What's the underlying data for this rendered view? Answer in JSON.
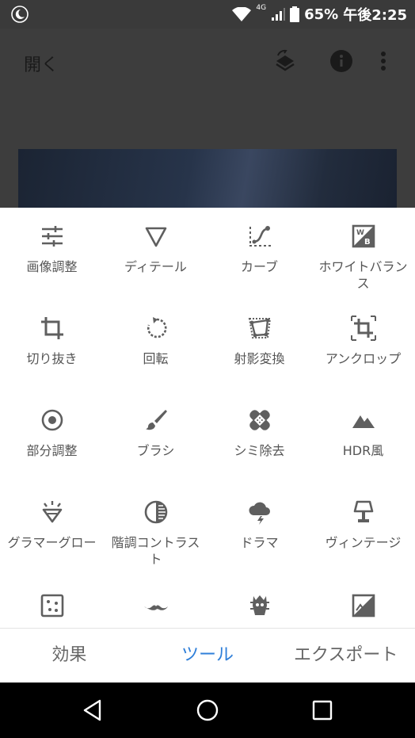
{
  "status_bar": {
    "network": "4G",
    "battery_percent": "65%",
    "time": "午後2:25",
    "icons": [
      "moon-icon",
      "wifi-icon",
      "signal-icon",
      "battery-icon"
    ]
  },
  "app_bar": {
    "open_label": "開く",
    "icons": [
      "layers-icon",
      "info-icon",
      "more-icon"
    ]
  },
  "tools": [
    {
      "label": "画像調整",
      "icon": "tune-icon"
    },
    {
      "label": "ディテール",
      "icon": "details-icon"
    },
    {
      "label": "カーブ",
      "icon": "curves-icon"
    },
    {
      "label": "ホワイトバランス",
      "icon": "white-balance-icon"
    },
    {
      "label": "切り抜き",
      "icon": "crop-icon"
    },
    {
      "label": "回転",
      "icon": "rotate-icon"
    },
    {
      "label": "射影変換",
      "icon": "perspective-icon"
    },
    {
      "label": "アンクロップ",
      "icon": "expand-icon"
    },
    {
      "label": "部分調整",
      "icon": "selective-icon"
    },
    {
      "label": "ブラシ",
      "icon": "brush-icon"
    },
    {
      "label": "シミ除去",
      "icon": "healing-icon"
    },
    {
      "label": "HDR風",
      "icon": "hdr-icon"
    },
    {
      "label": "グラマーグロー",
      "icon": "glamour-glow-icon"
    },
    {
      "label": "階調コントラスト",
      "icon": "tonal-contrast-icon"
    },
    {
      "label": "ドラマ",
      "icon": "drama-icon"
    },
    {
      "label": "ヴィンテージ",
      "icon": "vintage-icon"
    },
    {
      "label": "",
      "icon": "grainy-film-icon"
    },
    {
      "label": "",
      "icon": "mustache-icon"
    },
    {
      "label": "",
      "icon": "grunge-icon"
    },
    {
      "label": "",
      "icon": "black-white-icon"
    }
  ],
  "tabs": [
    {
      "label": "効果",
      "active": false
    },
    {
      "label": "ツール",
      "active": true
    },
    {
      "label": "エクスポート",
      "active": false
    }
  ],
  "nav_bar": {
    "icons": [
      "back-icon",
      "home-icon",
      "recents-icon"
    ]
  },
  "colors": {
    "accent": "#2f7fd9",
    "icon": "#5f5f5f",
    "label": "#555555"
  }
}
